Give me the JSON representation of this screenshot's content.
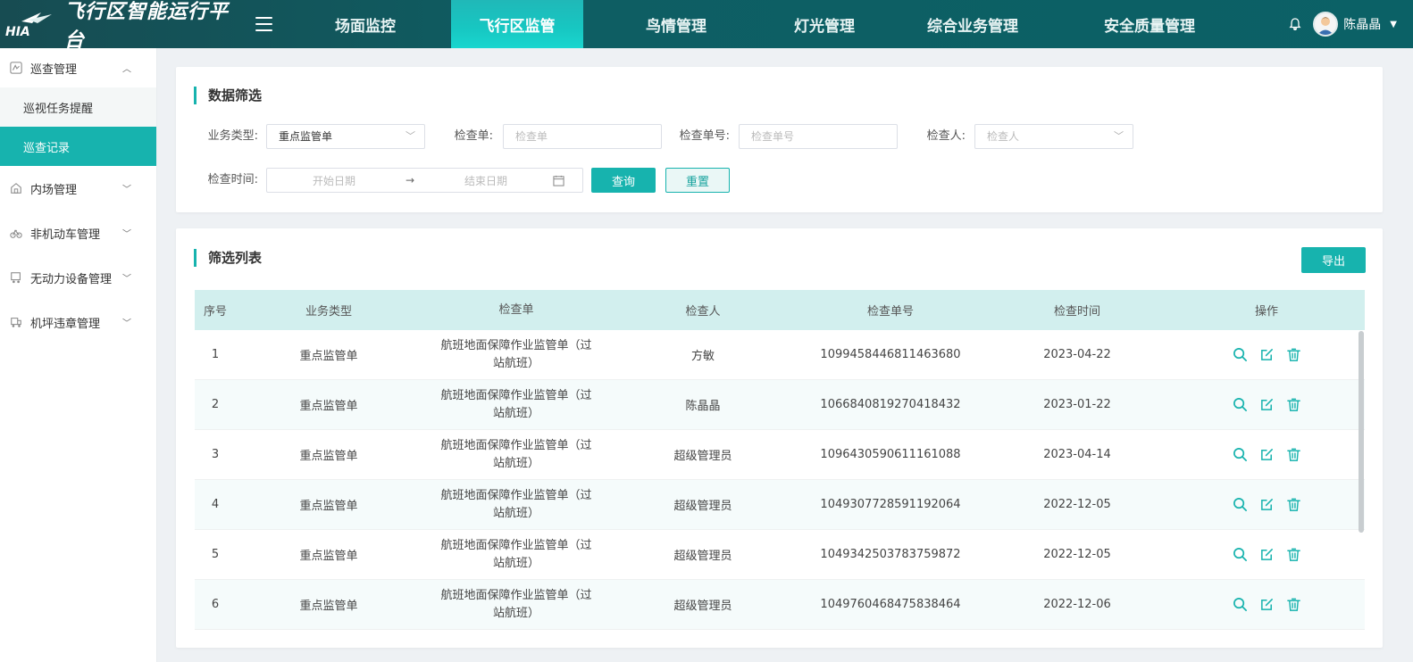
{
  "header": {
    "logo_text": "HIA",
    "title": "飞行区智能运行平台",
    "nav": [
      {
        "label": "场面监控",
        "active": false
      },
      {
        "label": "飞行区监管",
        "active": true
      },
      {
        "label": "鸟情管理",
        "active": false
      },
      {
        "label": "灯光管理",
        "active": false
      },
      {
        "label": "综合业务管理",
        "active": false
      },
      {
        "label": "安全质量管理",
        "active": false
      }
    ],
    "user_name": "陈晶晶"
  },
  "sidebar": {
    "groups": [
      {
        "label": "巡查管理",
        "icon": "patrol-icon",
        "expanded": true,
        "children": [
          {
            "label": "巡视任务提醒",
            "active": false
          },
          {
            "label": "巡查记录",
            "active": true
          }
        ]
      },
      {
        "label": "内场管理",
        "icon": "building-icon",
        "expanded": false
      },
      {
        "label": "非机动车管理",
        "icon": "bike-icon",
        "expanded": false
      },
      {
        "label": "无动力设备管理",
        "icon": "cart-icon",
        "expanded": false
      },
      {
        "label": "机坪违章管理",
        "icon": "violation-icon",
        "expanded": false
      }
    ]
  },
  "filter": {
    "title": "数据筛选",
    "business_type_label": "业务类型:",
    "business_type_value": "重点监管单",
    "check_form_label": "检查单:",
    "check_form_placeholder": "检查单",
    "check_no_label": "检查单号:",
    "check_no_placeholder": "检查单号",
    "inspector_label": "检查人:",
    "inspector_placeholder": "检查人",
    "time_label": "检查时间:",
    "start_placeholder": "开始日期",
    "end_placeholder": "结束日期",
    "query_button": "查询",
    "reset_button": "重置"
  },
  "list": {
    "title": "筛选列表",
    "export_button": "导出",
    "columns": [
      "序号",
      "业务类型",
      "检查单",
      "检查人",
      "检查单号",
      "检查时间",
      "操作"
    ],
    "rows": [
      {
        "no": "1",
        "type": "重点监管单",
        "form": "航班地面保障作业监管单（过站航班）",
        "inspector": "方敏",
        "check_no": "1099458446811463680",
        "time": "2023-04-22"
      },
      {
        "no": "2",
        "type": "重点监管单",
        "form": "航班地面保障作业监管单（过站航班）",
        "inspector": "陈晶晶",
        "check_no": "1066840819270418432",
        "time": "2023-01-22"
      },
      {
        "no": "3",
        "type": "重点监管单",
        "form": "航班地面保障作业监管单（过站航班）",
        "inspector": "超级管理员",
        "check_no": "1096430590611161088",
        "time": "2023-04-14"
      },
      {
        "no": "4",
        "type": "重点监管单",
        "form": "航班地面保障作业监管单（过站航班）",
        "inspector": "超级管理员",
        "check_no": "1049307728591192064",
        "time": "2022-12-05"
      },
      {
        "no": "5",
        "type": "重点监管单",
        "form": "航班地面保障作业监管单（过站航班）",
        "inspector": "超级管理员",
        "check_no": "1049342503783759872",
        "time": "2022-12-05"
      },
      {
        "no": "6",
        "type": "重点监管单",
        "form": "航班地面保障作业监管单（过站航班）",
        "inspector": "超级管理员",
        "check_no": "1049760468475838464",
        "time": "2022-12-06"
      }
    ]
  },
  "colors": {
    "accent": "#17b3ae",
    "header_dark": "#0e5e63"
  }
}
